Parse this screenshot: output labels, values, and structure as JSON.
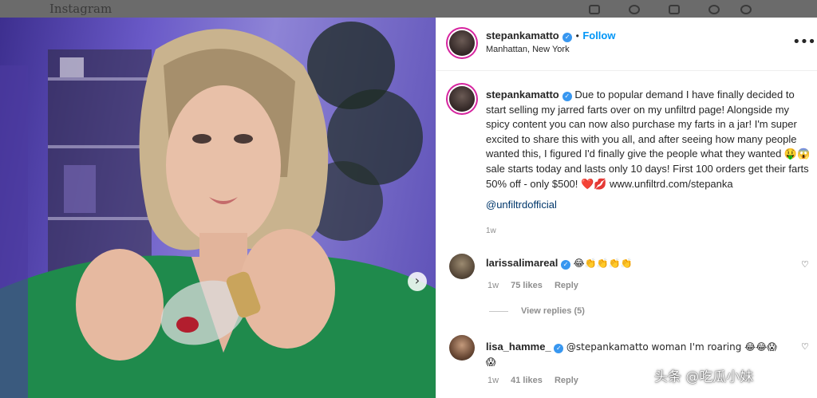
{
  "app": {
    "logo": "Instagram"
  },
  "post": {
    "author": "stepankamatto",
    "follow_label": "Follow",
    "separator": "•",
    "location": "Manhattan, New York",
    "more_glyph": "•••",
    "caption": "Due to popular demand I have finally decided to start selling my jarred farts over on my unfiltrd page! Alongside my spicy content you can now also purchase my farts in a jar! I'm super excited to share this with you all, and after seeing how many people wanted this, I figured I'd finally give the people what they wanted 🤑😱 sale starts today and lasts only 10 days! First 100 orders get their farts 50% off - only $500! ❤️💋 www.unfiltrd.com/stepanka",
    "mention": "@unfiltrdofficial",
    "time": "1w"
  },
  "comments": [
    {
      "user": "larissalimareal",
      "text": "😂👏👏👏👏",
      "time": "1w",
      "likes": "75 likes",
      "reply": "Reply",
      "view_replies": "View replies (5)"
    },
    {
      "user": "lisa_hamme_",
      "text": "@stepankamatto woman I'm roaring 😂😂😱",
      "text_line2": "😱",
      "time": "1w",
      "likes": "41 likes",
      "reply": "Reply"
    }
  ],
  "watermark": "头条 @吃瓜小妹",
  "icons": {
    "verified": "✓",
    "heart": "♡",
    "carousel_next": "›"
  },
  "colors": {
    "accent": "#0095f6",
    "verified": "#3897f0",
    "mention": "#00376b"
  }
}
